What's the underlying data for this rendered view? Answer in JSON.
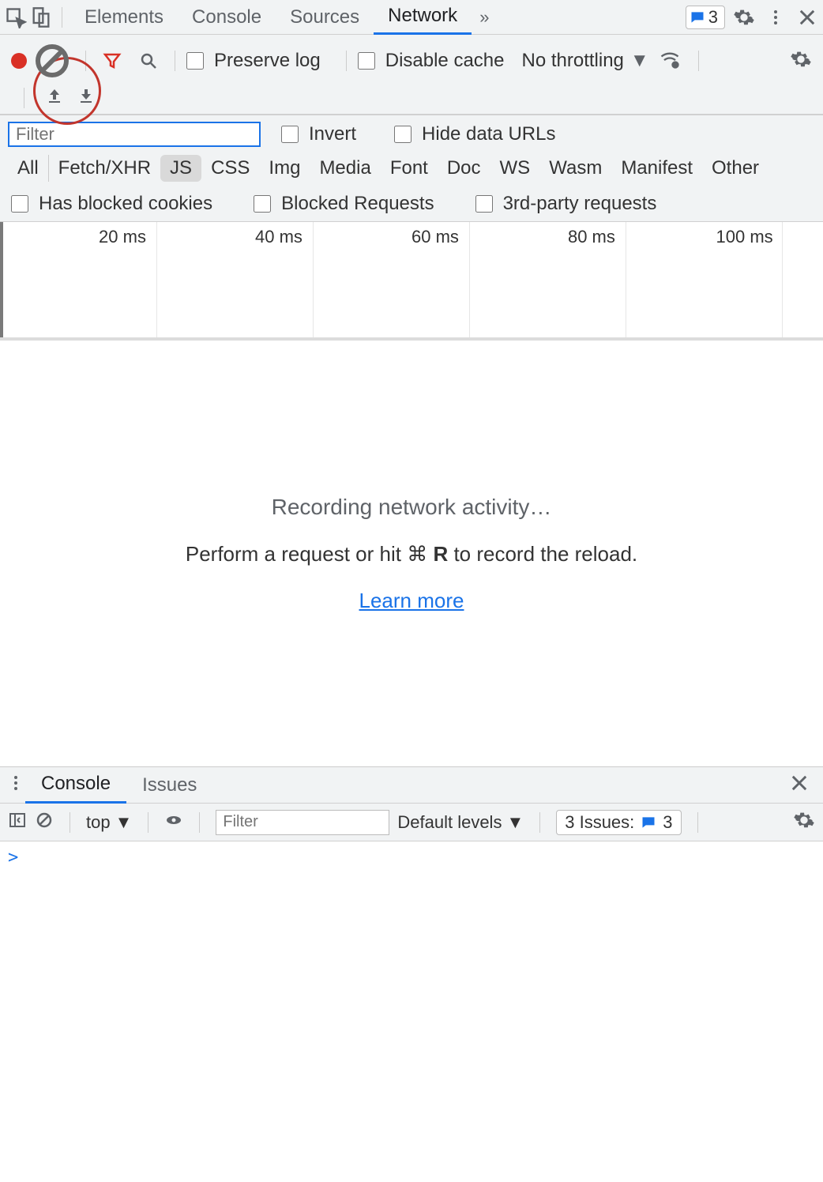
{
  "tabs": {
    "items": [
      "Elements",
      "Console",
      "Sources",
      "Network"
    ],
    "active_index": 3,
    "messages_count": "3"
  },
  "toolbar": {
    "preserve_log": "Preserve log",
    "disable_cache": "Disable cache",
    "throttling": "No throttling"
  },
  "filter": {
    "placeholder": "Filter",
    "invert": "Invert",
    "hide_data_urls": "Hide data URLs",
    "types": [
      "All",
      "Fetch/XHR",
      "JS",
      "CSS",
      "Img",
      "Media",
      "Font",
      "Doc",
      "WS",
      "Wasm",
      "Manifest",
      "Other"
    ],
    "selected_type_index": 2,
    "has_blocked_cookies": "Has blocked cookies",
    "blocked_requests": "Blocked Requests",
    "third_party": "3rd-party requests"
  },
  "timeline": {
    "ticks": [
      "20 ms",
      "40 ms",
      "60 ms",
      "80 ms",
      "100 ms"
    ]
  },
  "empty": {
    "title": "Recording network activity…",
    "hint_pre": "Perform a request or hit ",
    "hint_key1": "⌘",
    "hint_key2": "R",
    "hint_post": " to record the reload.",
    "learn_more": "Learn more"
  },
  "drawer": {
    "tabs": [
      "Console",
      "Issues"
    ],
    "active_index": 0
  },
  "console": {
    "context": "top",
    "filter_placeholder": "Filter",
    "levels": "Default levels",
    "issues_label": "3 Issues:",
    "issues_count": "3",
    "prompt": ">"
  }
}
